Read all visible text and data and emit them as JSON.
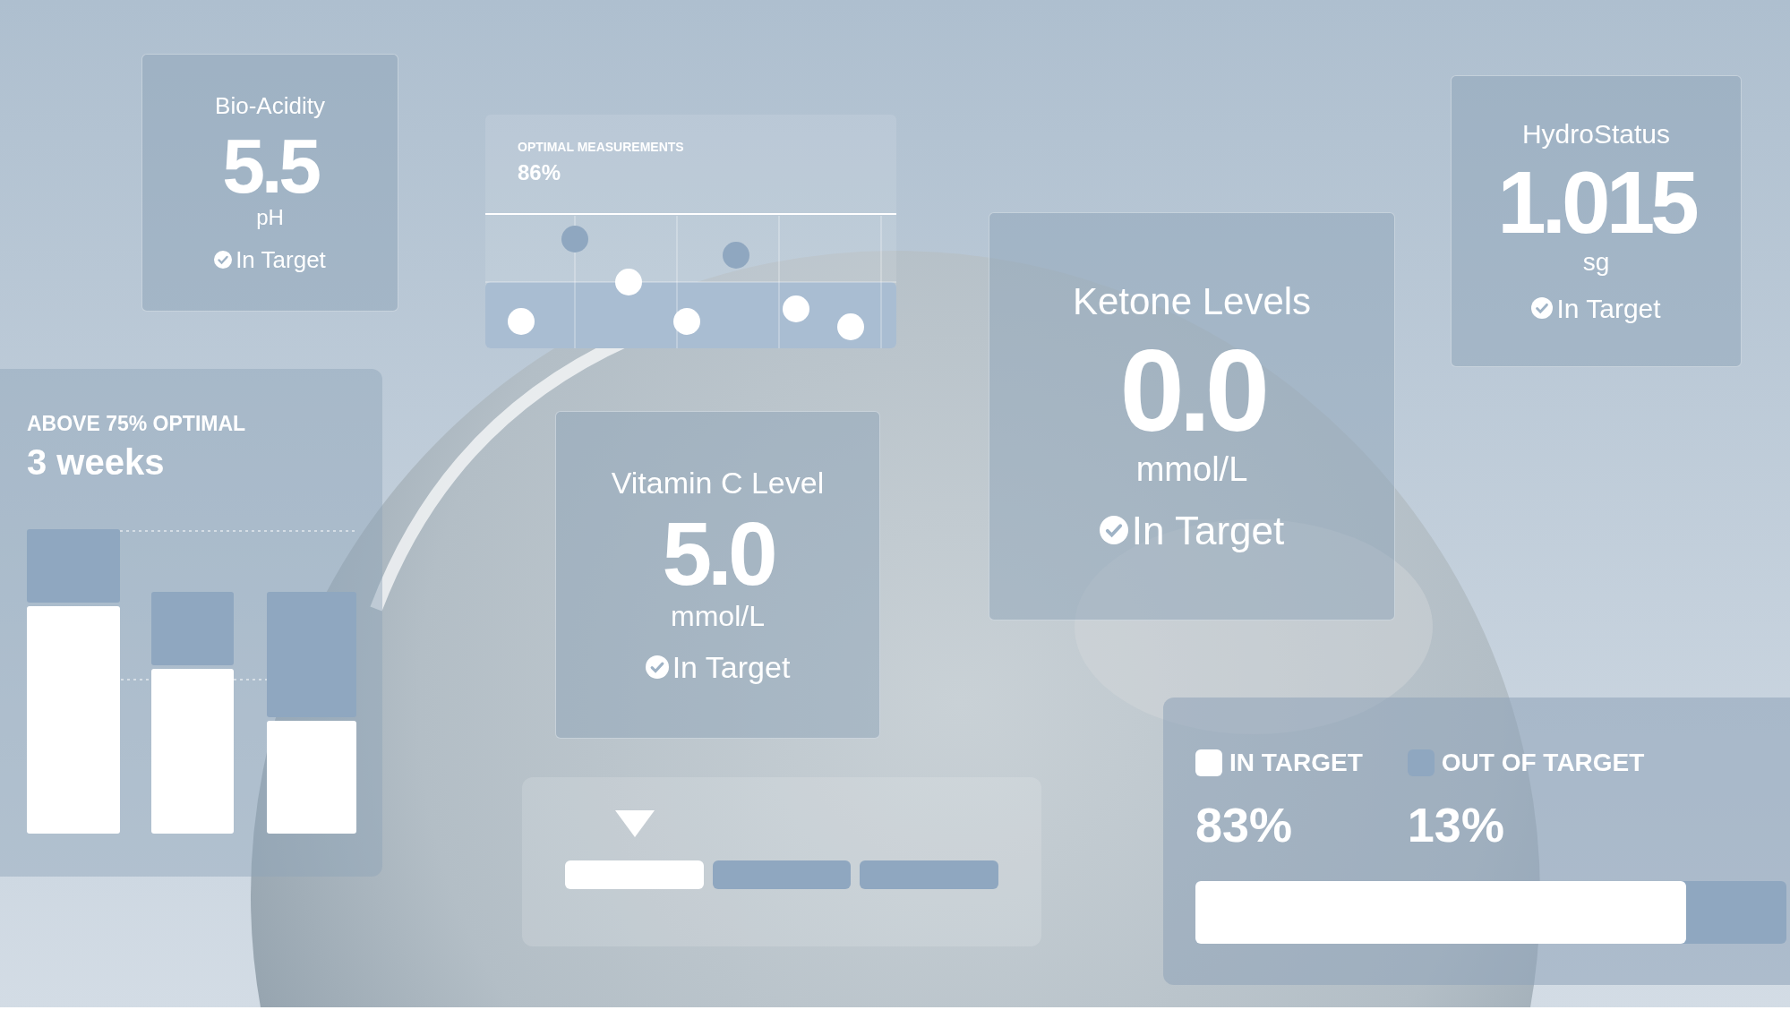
{
  "metric_cards": [
    {
      "kind": "small",
      "title": "Bio-Acidity",
      "value": "5.5",
      "unit": "pH",
      "status": "In Target"
    },
    {
      "kind": "medium",
      "title": "Vitamin C Level",
      "value": "5.0",
      "unit": "mmol/L",
      "status": "In Target"
    },
    {
      "kind": "large",
      "title": "Ketone Levels",
      "value": "0.0",
      "unit": "mmol/L",
      "status": "In Target"
    },
    {
      "kind": "tall",
      "title": "HydroStatus",
      "value": "1.015",
      "unit": "sg",
      "status": "In Target"
    }
  ],
  "measurements": {
    "label": "OPTIMAL MEASUREMENTS",
    "value": "86%"
  },
  "streak": {
    "label": "ABOVE 75% OPTIMAL",
    "value": "3 weeks"
  },
  "range": {
    "segments": [
      {
        "selected": true
      },
      {
        "selected": false
      },
      {
        "selected": false
      }
    ]
  },
  "target_summary": {
    "legend": [
      {
        "label": "IN TARGET",
        "value": "83%",
        "color": "#ffffff"
      },
      {
        "label": "OUT OF TARGET",
        "value": "13%",
        "color": "#8fa7c0"
      }
    ],
    "level": 0.83
  }
}
